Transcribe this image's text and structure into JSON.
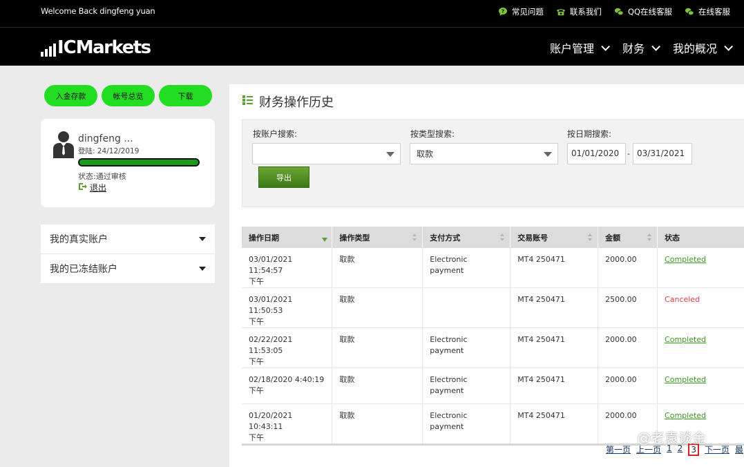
{
  "topbar": {
    "welcome": "Welcome Back dingfeng yuan",
    "links": [
      "常见问题",
      "联系我们",
      "QQ在线客服",
      "在线客服"
    ]
  },
  "navbar": {
    "logo_ic": "IC",
    "logo_markets": "Markets",
    "menu": [
      "账户管理",
      "财务",
      "我的概况"
    ]
  },
  "actions": [
    "入金存款",
    "帐号总览",
    "下载"
  ],
  "profile": {
    "name": "dingfeng ...",
    "login_label": "登陆: 24/12/2019",
    "status": "状态:通过审核",
    "logout": "退出"
  },
  "accounts": [
    "我的真实账户",
    "我的已冻结账户"
  ],
  "main": {
    "title": "财务操作历史",
    "filters": {
      "account_label": "按账户搜索:",
      "account_value": "",
      "type_label": "按类型搜索:",
      "type_value": "取款",
      "date_label": "按日期搜索:",
      "date_from": "01/01/2020",
      "date_sep": "-",
      "date_to": "03/31/2021",
      "export": "导出"
    },
    "table": {
      "headers": [
        "操作日期",
        "操作类型",
        "支付方式",
        "交易账号",
        "金额",
        "状态"
      ],
      "rows": [
        {
          "date": "03/01/2021 11:54:57",
          "ampm": "下午",
          "type": "取款",
          "method": "Electronic payment",
          "account": "MT4 250471",
          "amount": "2000.00",
          "status": "Completed"
        },
        {
          "date": "03/01/2021 11:50:53",
          "ampm": "下午",
          "type": "取款",
          "method": "",
          "account": "MT4 250471",
          "amount": "2500.00",
          "status": "Canceled"
        },
        {
          "date": "02/22/2021 11:53:05",
          "ampm": "下午",
          "type": "取款",
          "method": "Electronic payment",
          "account": "MT4 250471",
          "amount": "2000.00",
          "status": "Completed"
        },
        {
          "date": "02/18/2020 4:40:19",
          "ampm": "下午",
          "type": "取款",
          "method": "Electronic payment",
          "account": "MT4 250471",
          "amount": "2000.00",
          "status": "Completed"
        },
        {
          "date": "01/20/2021 10:43:11",
          "ampm": "下午",
          "type": "取款",
          "method": "Electronic payment",
          "account": "MT4 250471",
          "amount": "2000.00",
          "status": "Completed"
        }
      ]
    },
    "pager": {
      "first": "第一页",
      "prev": "上一页",
      "pages": [
        "1",
        "2",
        "3"
      ],
      "current": "3",
      "next": "下一页",
      "last": "最"
    }
  },
  "watermark": "@老袁谈金",
  "colors": {
    "accent_green": "#22dd22",
    "status_completed": "#3a9a1c",
    "status_canceled": "#e04040",
    "header_bg": "#000000"
  }
}
